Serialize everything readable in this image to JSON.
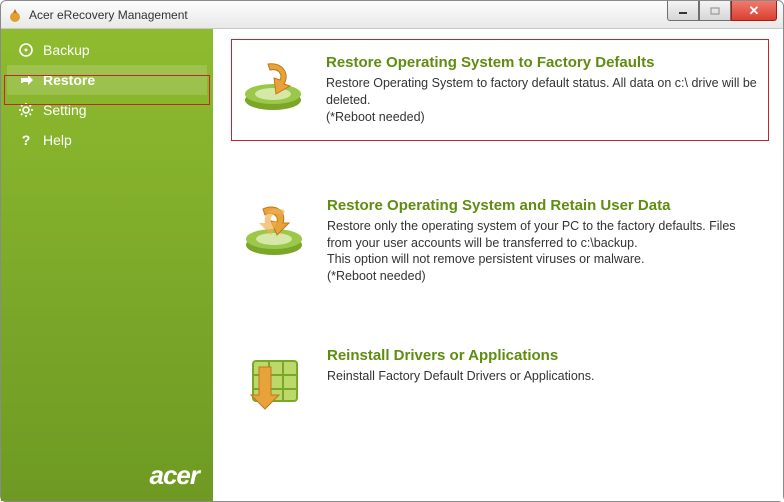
{
  "window": {
    "title": "Acer eRecovery Management"
  },
  "sidebar": {
    "items": [
      {
        "label": "Backup"
      },
      {
        "label": "Restore"
      },
      {
        "label": "Setting"
      },
      {
        "label": "Help"
      }
    ],
    "brand": "acer"
  },
  "options": [
    {
      "title": "Restore Operating System to Factory Defaults",
      "desc": "Restore Operating System to factory default status. All data on c:\\ drive will be deleted.\n(*Reboot needed)"
    },
    {
      "title": "Restore Operating System and Retain User Data",
      "desc": "Restore only the operating system of your PC to the factory defaults. Files from your user accounts will be transferred to c:\\backup.\nThis option will not remove persistent viruses or malware.\n(*Reboot needed)"
    },
    {
      "title": "Reinstall Drivers or Applications",
      "desc": "Reinstall Factory Default Drivers or Applications."
    }
  ]
}
